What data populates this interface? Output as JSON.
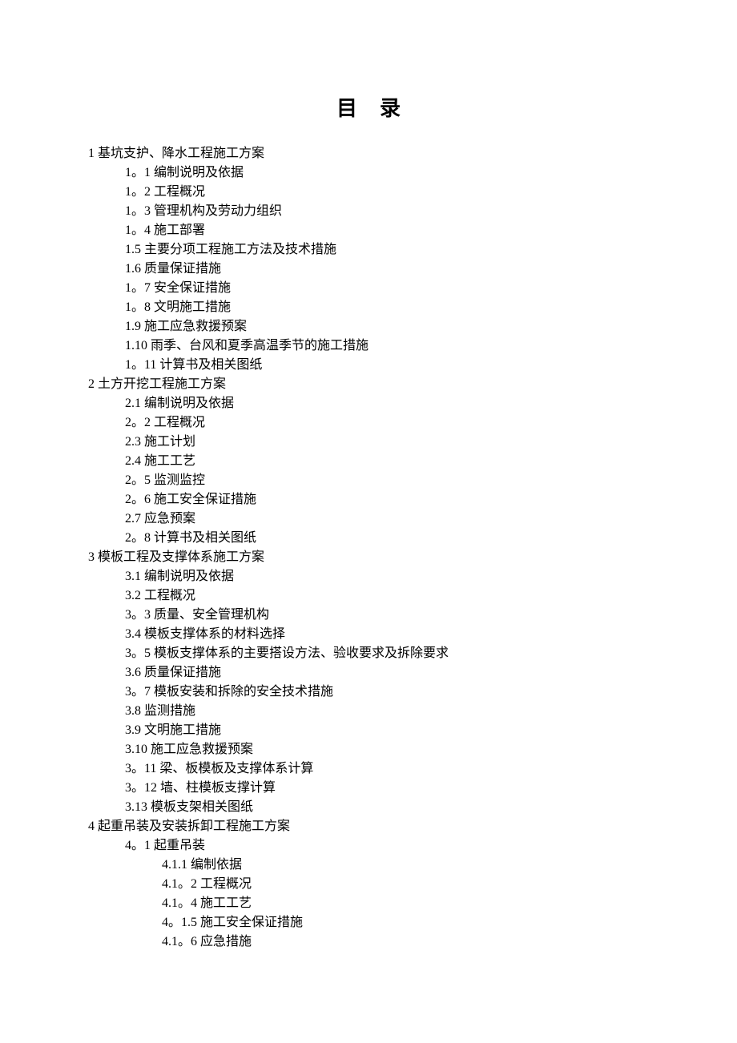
{
  "title": "目录",
  "toc": [
    {
      "level": 1,
      "text": "1 基坑支护、降水工程施工方案"
    },
    {
      "level": 2,
      "text": "1。1   编制说明及依据"
    },
    {
      "level": 2,
      "text": "1。2   工程概况"
    },
    {
      "level": 2,
      "text": "1。3   管理机构及劳动力组织"
    },
    {
      "level": 2,
      "text": "1。4   施工部署"
    },
    {
      "level": 2,
      "text": "1.5   主要分项工程施工方法及技术措施"
    },
    {
      "level": 2,
      "text": "1.6   质量保证措施"
    },
    {
      "level": 2,
      "text": "1。7   安全保证措施"
    },
    {
      "level": 2,
      "text": "1。8   文明施工措施"
    },
    {
      "level": 2,
      "text": "1.9   施工应急救援预案"
    },
    {
      "level": 2,
      "text": "1.10   雨季、台风和夏季高温季节的施工措施"
    },
    {
      "level": 2,
      "text": "1。11 计算书及相关图纸"
    },
    {
      "level": 1,
      "text": "2 土方开挖工程施工方案"
    },
    {
      "level": 2,
      "text": "2.1   编制说明及依据"
    },
    {
      "level": 2,
      "text": "2。2   工程概况"
    },
    {
      "level": 2,
      "text": "2.3  施工计划"
    },
    {
      "level": 2,
      "text": "2.4  施工工艺"
    },
    {
      "level": 2,
      "text": "2。5 监测监控"
    },
    {
      "level": 2,
      "text": "2。6 施工安全保证措施"
    },
    {
      "level": 2,
      "text": "2.7  应急预案"
    },
    {
      "level": 2,
      "text": "2。8 计算书及相关图纸"
    },
    {
      "level": 1,
      "text": "3  模板工程及支撑体系施工方案"
    },
    {
      "level": 2,
      "text": "3.1   编制说明及依据"
    },
    {
      "level": 2,
      "text": "3.2   工程概况"
    },
    {
      "level": 2,
      "text": "3。3   质量、安全管理机构"
    },
    {
      "level": 2,
      "text": "3.4   模板支撑体系的材料选择"
    },
    {
      "level": 2,
      "text": "3。5   模板支撑体系的主要搭设方法、验收要求及拆除要求"
    },
    {
      "level": 2,
      "text": "3.6   质量保证措施"
    },
    {
      "level": 2,
      "text": "3。7   模板安装和拆除的安全技术措施"
    },
    {
      "level": 2,
      "text": "3.8   监测措施"
    },
    {
      "level": 2,
      "text": "3.9   文明施工措施"
    },
    {
      "level": 2,
      "text": "3.10   施工应急救援预案"
    },
    {
      "level": 2,
      "text": "3。11   梁、板模板及支撑体系计算"
    },
    {
      "level": 2,
      "text": "3。12   墙、柱模板支撑计算"
    },
    {
      "level": 2,
      "text": "3.13   模板支架相关图纸"
    },
    {
      "level": 1,
      "text": "4 起重吊装及安装拆卸工程施工方案"
    },
    {
      "level": 2,
      "text": "4。1  起重吊装"
    },
    {
      "level": 3,
      "text": "4.1.1  编制依据"
    },
    {
      "level": 3,
      "text": "4.1。2  工程概况"
    },
    {
      "level": 3,
      "text": "4.1。4  施工工艺"
    },
    {
      "level": 3,
      "text": "4。1.5  施工安全保证措施"
    },
    {
      "level": 3,
      "text": "4.1。6  应急措施"
    }
  ]
}
